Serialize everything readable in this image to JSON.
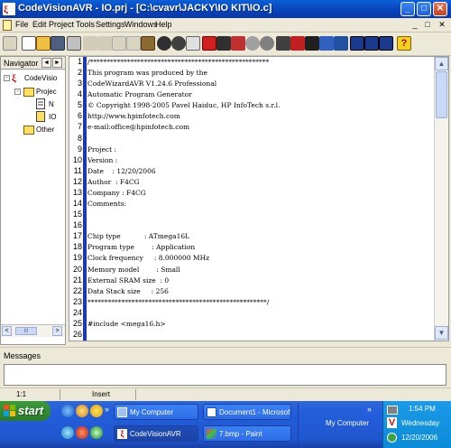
{
  "window": {
    "title": "CodeVisionAVR - IO.prj - [C:\\cvavr\\JACKY\\IO KIT\\IO.c]",
    "controls": {
      "minimize": "_",
      "maximize": "□",
      "close": "✕"
    }
  },
  "menu": {
    "items": [
      "File",
      "Edit",
      "Project",
      "Tools",
      "Settings",
      "Windows",
      "Help"
    ],
    "mdi_controls": [
      "_",
      "□",
      "✕"
    ]
  },
  "toolbar": {
    "icons": [
      "project-icon",
      "new-file-icon",
      "open-folder-icon",
      "save-icon",
      "print-icon",
      "undo-icon",
      "redo-icon",
      "cut-icon",
      "copy-icon",
      "paste-icon",
      "find-icon",
      "replace-icon",
      "goto-icon",
      "build-icon",
      "make-icon",
      "chip-icon",
      "debugger-icon",
      "programmer-icon",
      "terminal-icon",
      "wizard-icon",
      "settings-icon",
      "tool-icon",
      "tool-icon-2",
      "tile-icon",
      "cascade-icon",
      "help-icon"
    ]
  },
  "navigator": {
    "title": "Navigator",
    "arrows": [
      "◄",
      "►"
    ],
    "tree": [
      {
        "label": "CodeVisio",
        "level": 0,
        "icon": "codevision-logo-icon"
      },
      {
        "label": "Projec",
        "level": 1,
        "icon": "project-folder-icon"
      },
      {
        "label": "N",
        "level": 2,
        "icon": "file-icon"
      },
      {
        "label": "IO",
        "level": 2,
        "icon": "file-icon"
      },
      {
        "label": "Other",
        "level": 1,
        "icon": "other-folder-icon"
      }
    ],
    "hscroll": {
      "left": "<",
      "right": ">",
      "thumb": "III"
    }
  },
  "editor": {
    "lines": [
      {
        "n": "1",
        "text": "/*****************************************************"
      },
      {
        "n": "2",
        "text": "This program was produced by the"
      },
      {
        "n": "3",
        "text": "CodeWizardAVR V1.24.6 Professional"
      },
      {
        "n": "4",
        "text": "Automatic Program Generator"
      },
      {
        "n": "5",
        "text": "© Copyright 1998-2005 Pavel Haiduc, HP InfoTech s.r.l."
      },
      {
        "n": "6",
        "text": "http://www.hpinfotech.com"
      },
      {
        "n": "7",
        "text": "e-mail:office@hpinfotech.com"
      },
      {
        "n": "8",
        "text": ""
      },
      {
        "n": "9",
        "text": "Project :"
      },
      {
        "n": "10",
        "text": "Version :"
      },
      {
        "n": "11",
        "text": "Date    : 12/20/2006"
      },
      {
        "n": "12",
        "text": "Author  : F4CG"
      },
      {
        "n": "13",
        "text": "Company : F4CG"
      },
      {
        "n": "14",
        "text": "Comments:"
      },
      {
        "n": "15",
        "text": ""
      },
      {
        "n": "16",
        "text": ""
      },
      {
        "n": "17",
        "text": "Chip type           : ATmega16L"
      },
      {
        "n": "18",
        "text": "Program type        : Application"
      },
      {
        "n": "19",
        "text": "Clock frequency     : 8.000000 MHz"
      },
      {
        "n": "20",
        "text": "Memory model        : Small"
      },
      {
        "n": "21",
        "text": "External SRAM size  : 0"
      },
      {
        "n": "22",
        "text": "Data Stack size     : 256"
      },
      {
        "n": "23",
        "text": "*****************************************************/"
      },
      {
        "n": "24",
        "text": ""
      },
      {
        "n": "25",
        "text": "#include <mega16.h>"
      },
      {
        "n": "26",
        "text": ""
      }
    ]
  },
  "messages": {
    "title": "Messages",
    "content": ""
  },
  "status": {
    "position": "1:1",
    "mode": "Insert"
  },
  "taskbar": {
    "start_label": "start",
    "quicklaunch": [
      "ie-icon",
      "outlook-icon",
      "messenger-icon",
      "media-icon",
      "winamp-icon",
      "shell-icon"
    ],
    "chevron": "»",
    "row1": [
      {
        "label": "My Computer",
        "icon": "my-computer-icon",
        "active": false
      },
      {
        "label": "Document1 - Microsof...",
        "icon": "word-doc-icon",
        "active": false
      }
    ],
    "row2": [
      {
        "label": "CodeVisionAVR",
        "icon": "codevision-task-icon",
        "active": true
      },
      {
        "label": "7.bmp - Paint",
        "icon": "paint-icon",
        "active": false
      }
    ],
    "address_toolbar": "My Computer",
    "tray": {
      "time": "1:54 PM",
      "day": "Wednesday",
      "date": "12/20/2006"
    }
  },
  "colors": {
    "title_bar": "#0842b8",
    "marker_bar": "#1a3ab0",
    "start_button": "#2f8a2f",
    "taskbar": "#245edb",
    "tray": "#0c8bd8"
  }
}
